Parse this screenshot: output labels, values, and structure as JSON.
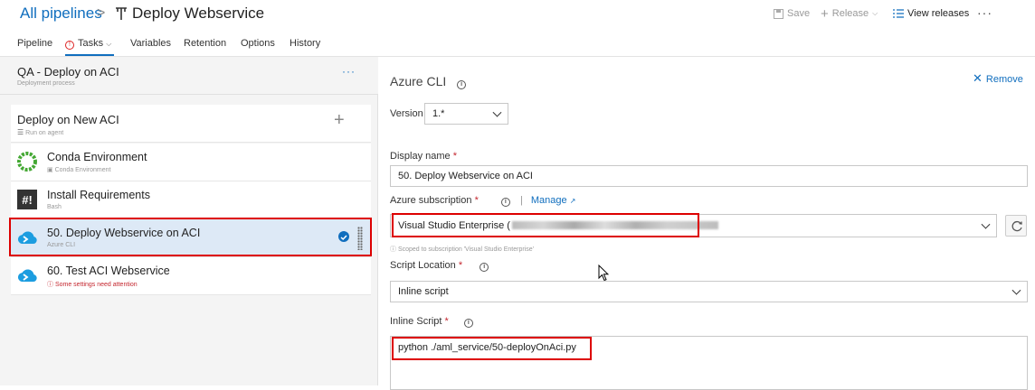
{
  "header": {
    "breadcrumb_root": "All pipelines",
    "breadcrumb_sep": ">",
    "title": "Deploy Webservice",
    "save_label": "Save",
    "release_label": "Release",
    "view_releases_label": "View releases",
    "more_label": "···"
  },
  "tabs": [
    "Pipeline",
    "Tasks",
    "Variables",
    "Retention",
    "Options",
    "History"
  ],
  "left": {
    "stage_title": "QA - Deploy on ACI",
    "stage_subtitle": "Deployment process",
    "stage_more": "···",
    "job_title": "Deploy on New ACI",
    "job_subtitle": "Run on agent",
    "tasks": [
      {
        "title": "Conda Environment",
        "subtitle": "Conda Environment",
        "icon": "conda-icon"
      },
      {
        "title": "Install Requirements",
        "subtitle": "Bash",
        "icon": "bash-icon"
      },
      {
        "title": "50. Deploy Webservice on ACI",
        "subtitle": "Azure CLI",
        "icon": "azure-cli-icon"
      },
      {
        "title": "60. Test ACI Webservice",
        "subtitle": "Some settings need attention",
        "icon": "azure-cli-icon"
      }
    ]
  },
  "panel": {
    "title": "Azure CLI",
    "remove_label": "Remove",
    "version_label": "Version",
    "version_value": "1.*",
    "display_name_label": "Display name",
    "display_name_value": "50. Deploy Webservice on ACI",
    "subscription_label": "Azure subscription",
    "manage_label": "Manage",
    "subscription_value": "Visual Studio Enterprise (",
    "subscription_note": "Scoped to subscription 'Visual Studio Enterprise'",
    "script_location_label": "Script Location",
    "script_location_value": "Inline script",
    "inline_script_label": "Inline Script",
    "inline_script_value": "python ./aml_service/50-deployOnAci.py",
    "required_mark": "*"
  },
  "colors": {
    "accent": "#106ebe",
    "highlight": "#dd0000",
    "selected_row": "#dde9f6",
    "warning": "#c4262e"
  }
}
